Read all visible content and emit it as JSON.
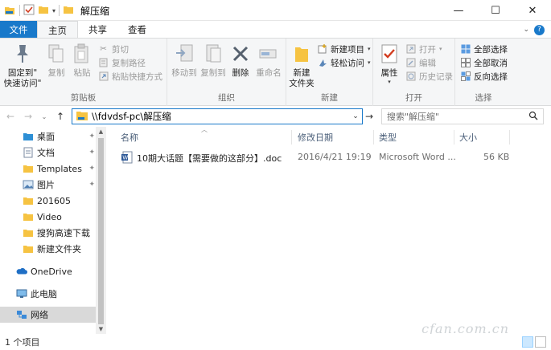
{
  "window": {
    "title": "解压缩",
    "minimize": "—",
    "maximize": "☐",
    "close": "✕"
  },
  "tabs": {
    "file": "文件",
    "home": "主页",
    "share": "共享",
    "view": "查看"
  },
  "ribbon": {
    "clipboard": {
      "pin_label_1": "固定到\"",
      "pin_label_2": "快速访问\"",
      "copy": "复制",
      "paste": "粘贴",
      "cut": "剪切",
      "copy_path": "复制路径",
      "paste_shortcut": "粘贴快捷方式",
      "group": "剪贴板"
    },
    "organize": {
      "move_to": "移动到",
      "copy_to": "复制到",
      "delete": "删除",
      "rename": "重命名",
      "group": "组织"
    },
    "new": {
      "new_folder_1": "新建",
      "new_folder_2": "文件夹",
      "new_item": "新建项目",
      "easy_access": "轻松访问",
      "group": "新建"
    },
    "open": {
      "properties": "属性",
      "open": "打开",
      "edit": "编辑",
      "history": "历史记录",
      "group": "打开"
    },
    "select": {
      "select_all": "全部选择",
      "select_none": "全部取消",
      "invert": "反向选择",
      "group": "选择"
    }
  },
  "address": {
    "path": "\\\\fdvdsf-pc\\解压缩",
    "search_placeholder": "搜索\"解压缩\""
  },
  "nav": {
    "items": [
      {
        "label": "桌面",
        "pinned": true
      },
      {
        "label": "文档",
        "pinned": true
      },
      {
        "label": "Templates",
        "pinned": true
      },
      {
        "label": "图片",
        "pinned": true
      },
      {
        "label": "201605",
        "pinned": false
      },
      {
        "label": "Video",
        "pinned": false
      },
      {
        "label": "搜狗高速下载",
        "pinned": false
      },
      {
        "label": "新建文件夹",
        "pinned": false
      },
      {
        "label": "OneDrive",
        "pinned": false
      },
      {
        "label": "此电脑",
        "pinned": false
      },
      {
        "label": "网络",
        "pinned": false
      }
    ]
  },
  "columns": {
    "name": "名称",
    "date": "修改日期",
    "type": "类型",
    "size": "大小"
  },
  "files": [
    {
      "name": "10期大话题【需要做的这部分】.doc",
      "date": "2016/4/21 19:19",
      "type": "Microsoft Word ...",
      "size": "56 KB"
    }
  ],
  "status": {
    "count": "1 个项目"
  },
  "watermark": "cfan.com.cn",
  "colors": {
    "accent": "#1979ca",
    "folder": "#f6c342"
  }
}
